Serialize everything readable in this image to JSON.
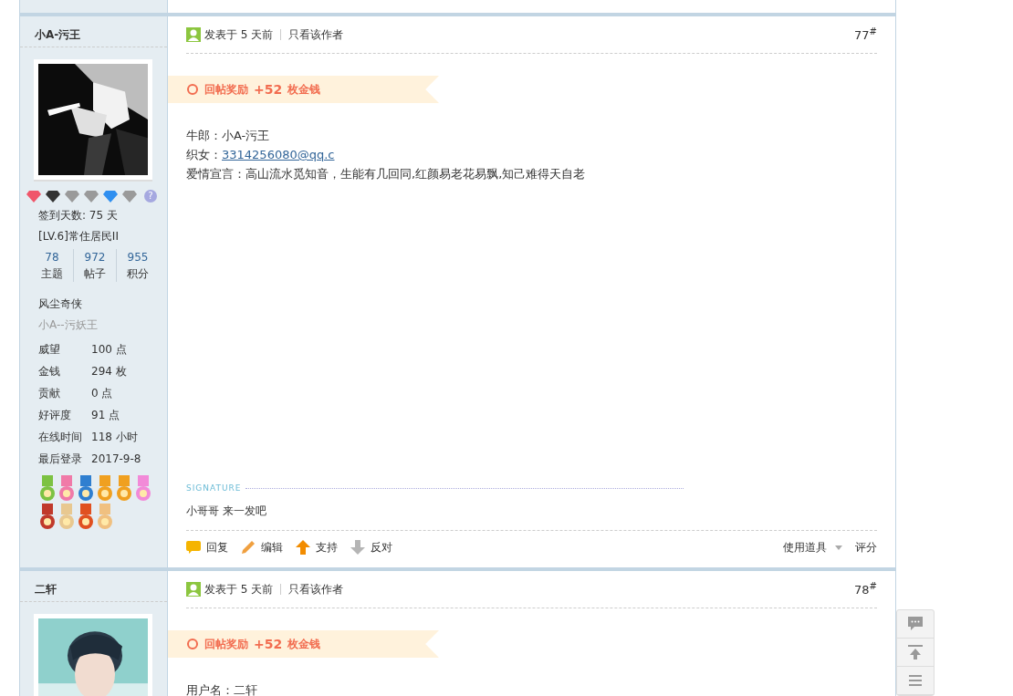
{
  "posts": [
    {
      "author": "小A-污王",
      "avatar": {
        "kind": "picture"
      },
      "gems": [
        {
          "color": "#f0566a"
        },
        {
          "color": "#333333"
        },
        {
          "color": "#9a9a9a"
        },
        {
          "color": "#9a9a9a"
        },
        {
          "color": "#2f8ff0"
        },
        {
          "color": "#9a9a9a"
        }
      ],
      "help_mark": "?",
      "sign_in": "签到天数: 75 天",
      "level": "[LV.6]常住居民II",
      "counts": [
        {
          "value": "78",
          "label": "主题"
        },
        {
          "value": "972",
          "label": "帖子"
        },
        {
          "value": "955",
          "label": "积分"
        }
      ],
      "group": "风尘奇侠",
      "custom_title": "小A--污妖王",
      "info": [
        {
          "label": "威望",
          "value": "100 点"
        },
        {
          "label": "金钱",
          "value": "294 枚"
        },
        {
          "label": "贡献",
          "value": "0 点"
        },
        {
          "label": "好评度",
          "value": "91 点"
        },
        {
          "label": "在线时间",
          "value": "118 小时"
        },
        {
          "label": "最后登录",
          "value": "2017-9-8"
        }
      ],
      "medals": [
        {
          "color": "#7cc242"
        },
        {
          "color": "#f07aa8"
        },
        {
          "color": "#2f7fd0"
        },
        {
          "color": "#f0a020"
        },
        {
          "color": "#f0a020"
        },
        {
          "color": "#f28ad8"
        },
        {
          "color": "#c0392b"
        },
        {
          "color": "#e8c890"
        },
        {
          "color": "#e05020"
        },
        {
          "color": "#f0c080"
        }
      ],
      "posted": "发表于 5 天前",
      "only_author": "只看该作者",
      "floor": "77",
      "floor_mark": "#",
      "reward": {
        "label": "回帖奖励",
        "amount": "+52",
        "unit": "枚金钱"
      },
      "lines": [
        {
          "text": "牛郎：小A-污王"
        },
        {
          "text": "织女：",
          "link": "3314256080@qq.c"
        },
        {
          "text": "爱情宣言：高山流水觅知音，生能有几回同,红颜易老花易飘,知己难得天自老"
        }
      ],
      "signature_label": "SIGNATURE",
      "signature": "小哥哥 来一发吧",
      "actions": [
        {
          "kind": "reply",
          "label": "回复"
        },
        {
          "kind": "edit",
          "label": "编辑"
        },
        {
          "kind": "support",
          "label": "支持"
        },
        {
          "kind": "oppose",
          "label": "反对"
        }
      ],
      "tools": "使用道具",
      "rate": "评分"
    },
    {
      "author": "二轩",
      "avatar": {
        "kind": "picture"
      },
      "posted": "发表于 5 天前",
      "only_author": "只看该作者",
      "floor": "78",
      "floor_mark": "#",
      "reward": {
        "label": "回帖奖励",
        "amount": "+52",
        "unit": "枚金钱"
      },
      "lines": [
        {
          "text": "用户名：二轩"
        }
      ]
    }
  ]
}
